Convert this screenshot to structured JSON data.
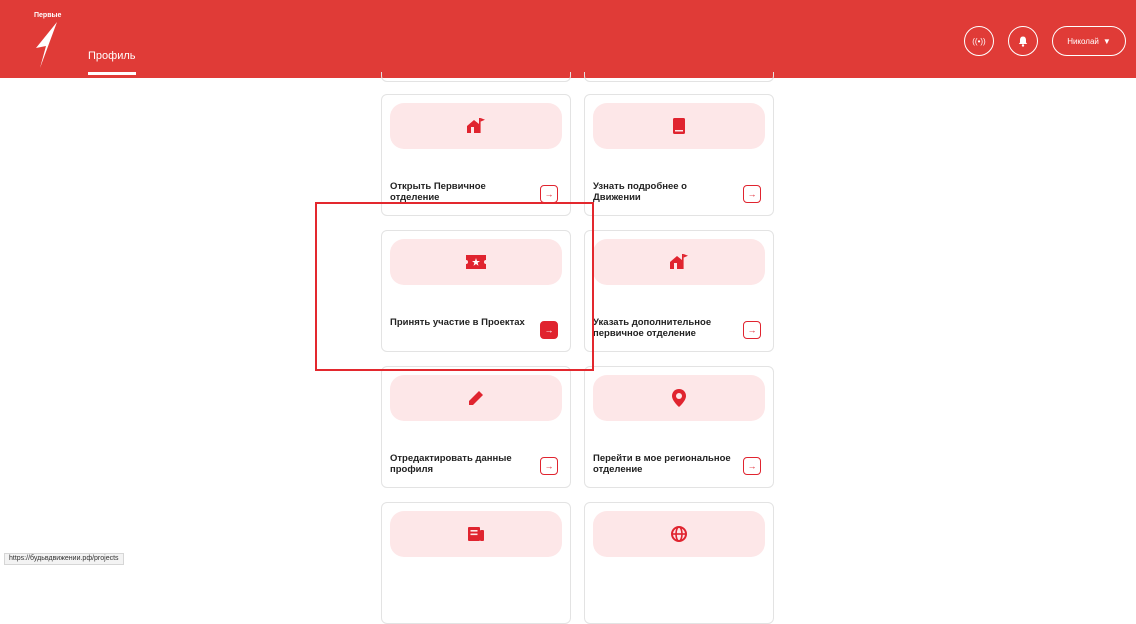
{
  "header": {
    "logo_text": "Первые",
    "nav_tab": "Профиль",
    "user_name": "Николай",
    "colors": {
      "brand": "#e03b37",
      "accent": "#e0242f",
      "card_band": "#fde7e8"
    }
  },
  "cards": [
    {
      "label": "Открыть Первичное отделение",
      "icon": "house-flag-icon"
    },
    {
      "label": "Узнать подробнее о Движении",
      "icon": "book-icon"
    },
    {
      "label": "Принять участие в Проектах",
      "icon": "ticket-star-icon"
    },
    {
      "label": "Указать дополнительное первичное отделение",
      "icon": "house-flag-icon"
    },
    {
      "label": "Отредактировать данные профиля",
      "icon": "pencil-icon"
    },
    {
      "label": "Перейти в мое региональное отделение",
      "icon": "location-pin-icon"
    },
    {
      "label": "",
      "icon": "newspaper-icon"
    },
    {
      "label": "",
      "icon": "globe-icon"
    }
  ],
  "status_url": "https://будьвдвижении.рф/projects"
}
